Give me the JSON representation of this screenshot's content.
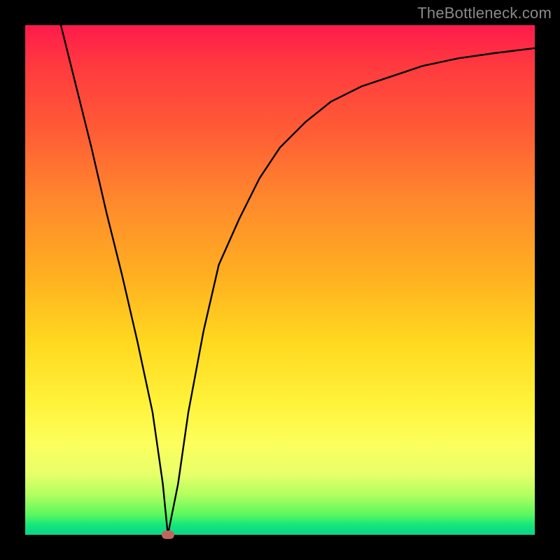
{
  "watermark": "TheBottleneck.com",
  "colors": {
    "page_bg": "#000000",
    "watermark": "#8a8a8a",
    "curve": "#000000",
    "marker": "#c0655d"
  },
  "chart_data": {
    "type": "line",
    "title": "",
    "xlabel": "",
    "ylabel": "",
    "xlim": [
      0,
      100
    ],
    "ylim": [
      0,
      100
    ],
    "grid": false,
    "legend": false,
    "series": [
      {
        "name": "bottleneck-curve",
        "x": [
          7,
          10,
          13,
          16,
          19,
          22,
          25,
          27,
          28,
          30,
          32,
          35,
          38,
          42,
          46,
          50,
          55,
          60,
          66,
          72,
          78,
          85,
          92,
          100
        ],
        "values": [
          100,
          88,
          76,
          63,
          51,
          38,
          24,
          10,
          0,
          10,
          24,
          40,
          53,
          62,
          70,
          76,
          81,
          85,
          88,
          90,
          92,
          93.5,
          94.5,
          95.5
        ]
      }
    ],
    "background_gradient": {
      "direction": "top-to-bottom",
      "stops": [
        {
          "pct": 0,
          "color": "#ff1a4c"
        },
        {
          "pct": 20,
          "color": "#ff5a36"
        },
        {
          "pct": 50,
          "color": "#ffb220"
        },
        {
          "pct": 74,
          "color": "#fff23a"
        },
        {
          "pct": 92,
          "color": "#b4ff60"
        },
        {
          "pct": 100,
          "color": "#0ad48c"
        }
      ]
    },
    "marker": {
      "x": 28,
      "y": 0
    }
  }
}
